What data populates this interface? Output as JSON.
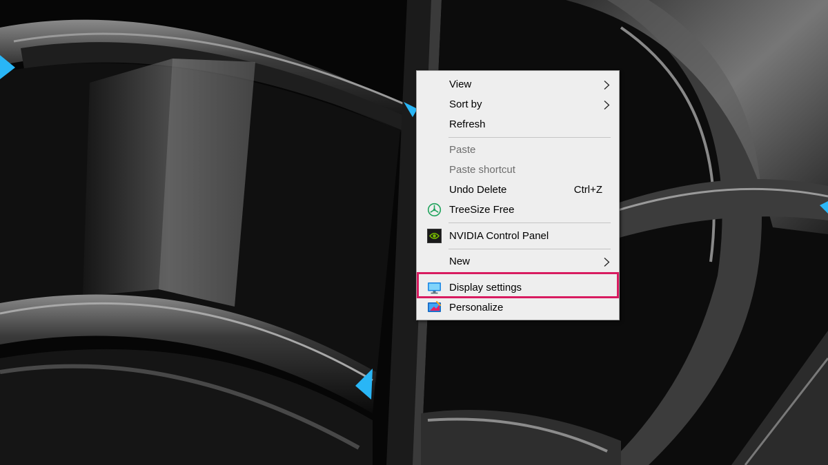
{
  "context_menu": {
    "items": [
      {
        "label": "View",
        "has_submenu": true,
        "enabled": true
      },
      {
        "label": "Sort by",
        "has_submenu": true,
        "enabled": true
      },
      {
        "label": "Refresh",
        "enabled": true
      },
      {
        "label": "Paste",
        "enabled": false
      },
      {
        "label": "Paste shortcut",
        "enabled": false
      },
      {
        "label": "Undo Delete",
        "shortcut": "Ctrl+Z",
        "enabled": true
      },
      {
        "label": "TreeSize Free",
        "icon": "treesize-icon",
        "enabled": true
      },
      {
        "label": "NVIDIA Control Panel",
        "icon": "nvidia-icon",
        "enabled": true
      },
      {
        "label": "New",
        "has_submenu": true,
        "enabled": true
      },
      {
        "label": "Display settings",
        "icon": "display-monitor-icon",
        "enabled": true,
        "highlighted": true
      },
      {
        "label": "Personalize",
        "icon": "personalize-icon",
        "enabled": true
      }
    ]
  },
  "colors": {
    "highlight_border": "#d81b60",
    "menu_background": "#eeeeee",
    "disabled_text": "#6d6d6d",
    "wallpaper_accent": "#29b6f6"
  }
}
